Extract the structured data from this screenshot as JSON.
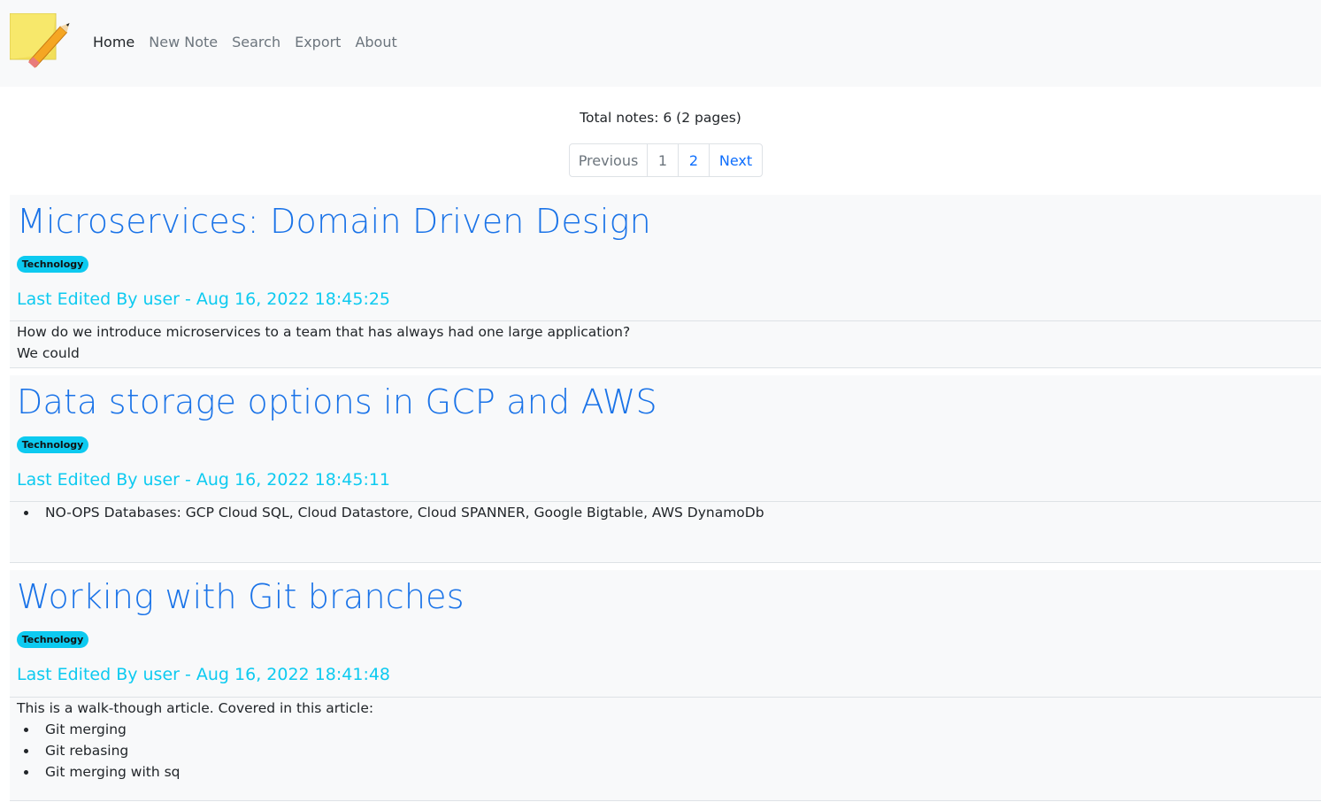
{
  "navbar": {
    "logo_icon": "sticky-note-pencil-icon",
    "links": [
      "Home",
      "New Note",
      "Search",
      "Export",
      "About"
    ]
  },
  "summary": "Total notes: 6 (2 pages)",
  "pagination": {
    "previous": "Previous",
    "pages": [
      "1",
      "2"
    ],
    "next": "Next"
  },
  "notes": [
    {
      "title": "Microservices: Domain Driven Design",
      "tag": "Technology",
      "edited": "Last Edited By user - Aug 16, 2022 18:45:25",
      "body_lines": [
        "How do we introduce microservices to a team that has always had one large application?",
        "We could"
      ]
    },
    {
      "title": "Data storage options in GCP and AWS",
      "tag": "Technology",
      "edited": "Last Edited By user - Aug 16, 2022 18:45:11",
      "body_items": [
        "NO-OPS Databases: GCP Cloud SQL, Cloud Datastore, Cloud SPANNER, Google Bigtable, AWS DynamoDb"
      ]
    },
    {
      "title": "Working with Git branches",
      "tag": "Technology",
      "edited": "Last Edited By user - Aug 16, 2022 18:41:48",
      "body_lines": [
        "This is a walk-though article. Covered in this article:"
      ],
      "body_items": [
        "Git merging",
        "Git rebasing",
        "Git merging with sq"
      ]
    }
  ],
  "colors": {
    "title_blue": "#1a73e8",
    "tag_cyan": "#0dcaf0",
    "link_blue": "#0d6efd"
  }
}
